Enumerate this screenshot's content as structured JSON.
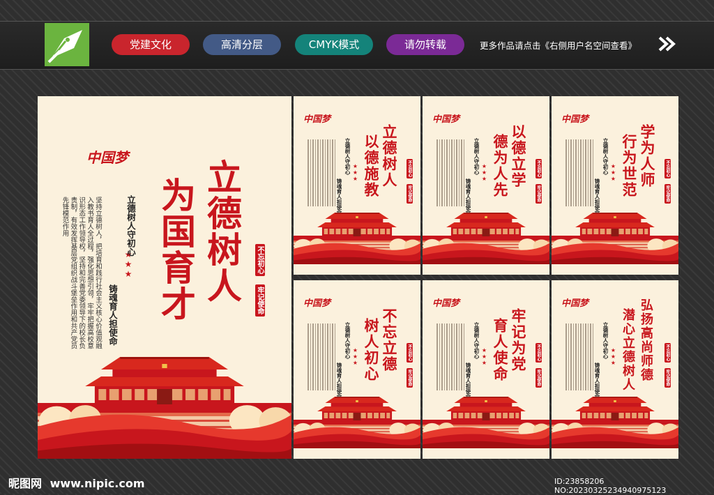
{
  "header": {
    "tags": [
      {
        "label": "党建文化",
        "color": "#c9252d"
      },
      {
        "label": "高清分层",
        "color": "#435a86"
      },
      {
        "label": "CMYK模式",
        "color": "#14837a"
      },
      {
        "label": "请勿转载",
        "color": "#7b2a96"
      }
    ],
    "tagline": "更多作品请点击《右侧用户名空间查看》",
    "logo_icon": "pen-nib-icon",
    "arrow_icon": "double-chevron-right-icon"
  },
  "colors": {
    "accent": "#c8161d",
    "poster_bg": "#fbf1dd",
    "logo_bg": "#6bb43f"
  },
  "main_poster": {
    "deco": "中国梦",
    "title": "立德树人为国育才",
    "title_col1": "立德树人",
    "title_col2": "为国育才",
    "slogan_col1": "立德树人守初心",
    "slogan_col2": "铸魂育人担使命",
    "body": "坚持立德树人，把培育和践行社会主义核心价值观融入教书育人全过程，强化思想引领，牢牢把握高校意识形态工作领导权，坚持和完善党委领导下的校长负责制，有效发挥基层党组织战斗堡垒作用和共产党员先锋模范作用",
    "seal_left": "不忘初心",
    "seal_right": "牢记使命"
  },
  "small_posters": [
    {
      "title_col1": "立德树人",
      "title_col2": "以德施教",
      "slogan_col1": "立德树人守初心",
      "slogan_col2": "铸魂育人担使命",
      "seal_left": "不忘初心",
      "seal_right": "牢记使命"
    },
    {
      "title_col1": "以德立学",
      "title_col2": "德为人先",
      "slogan_col1": "立德树人守初心",
      "slogan_col2": "铸魂育人担使命",
      "seal_left": "不忘初心",
      "seal_right": "牢记使命"
    },
    {
      "title_col1": "学为人师",
      "title_col2": "行为世范",
      "slogan_col1": "立德树人守初心",
      "slogan_col2": "铸魂育人担使命",
      "seal_left": "不忘初心",
      "seal_right": "牢记使命"
    },
    {
      "title_col1": "不忘立德",
      "title_col2": "树人初心",
      "slogan_col1": "立德树人守初心",
      "slogan_col2": "铸魂育人担使命",
      "seal_left": "不忘初心",
      "seal_right": "牢记使命"
    },
    {
      "title_col1": "牢记为党",
      "title_col2": "育人使命",
      "slogan_col1": "立德树人守初心",
      "slogan_col2": "铸魂育人担使命",
      "seal_left": "不忘初心",
      "seal_right": "牢记使命"
    },
    {
      "title_col1": "弘扬高尚师德",
      "title_col2": "潜心立德树人",
      "slogan_col1": "立德树人守初心",
      "slogan_col2": "铸魂育人担使命",
      "seal_left": "不忘初心",
      "seal_right": "牢记使命"
    }
  ],
  "footer": {
    "brand": "昵图网",
    "url": "www.nipic.com",
    "id_text": "ID:23858206 NO:20230325234940975123"
  }
}
